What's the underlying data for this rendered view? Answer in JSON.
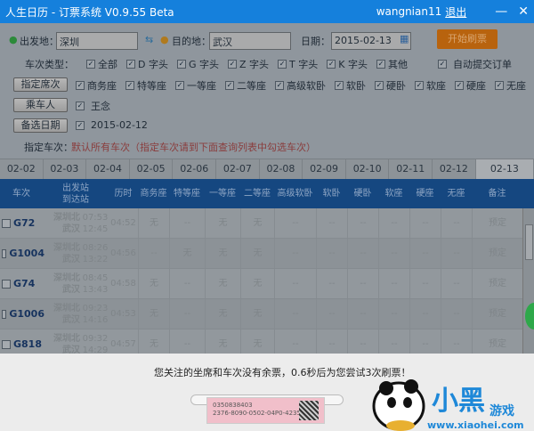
{
  "titlebar": {
    "title": "人生日历 - 订票系统 V0.9.55 Beta",
    "user": "wangnian11",
    "logout": "退出",
    "minimize": "—",
    "close": "✕"
  },
  "form": {
    "from_label": "出发地：",
    "from_value": "深圳",
    "to_label": "目的地：",
    "to_value": "武汉",
    "date_label": "日期：",
    "date_value": "2015-02-13",
    "start_button": "开始刷票",
    "train_type_label": "车次类型：",
    "train_types": [
      "全部",
      "D 字头",
      "G 字头",
      "Z 字头",
      "T 字头",
      "K 字头",
      "其他"
    ],
    "auto_submit": "自动提交订单",
    "seat_button": "指定席次",
    "seats": [
      "商务座",
      "特等座",
      "一等座",
      "二等座",
      "高级软卧",
      "软卧",
      "硬卧",
      "软座",
      "硬座",
      "无座"
    ],
    "passenger_button": "乘车人",
    "passenger": "王念",
    "alt_date_button": "备选日期",
    "alt_date": "2015-02-12",
    "train_label": "指定车次：",
    "train_hint": "默认所有车次（指定车次请到下面查询列表中勾选车次）"
  },
  "date_tabs": [
    "02-02",
    "02-03",
    "02-04",
    "02-05",
    "02-06",
    "02-07",
    "02-08",
    "02-09",
    "02-10",
    "02-11",
    "02-12",
    "02-13"
  ],
  "table": {
    "headers": {
      "train": "车次",
      "station1": "出发站",
      "station2": "到达站",
      "duration": "历时",
      "seats": [
        "商务座",
        "特等座",
        "一等座",
        "二等座",
        "高级软卧",
        "软卧",
        "硬卧",
        "软座",
        "硬座",
        "无座"
      ],
      "note": "备注"
    },
    "rows": [
      {
        "code": "G72",
        "from": "深圳北",
        "to": "武汉",
        "dep": "07:53",
        "arr": "12:45",
        "dur": "04:52",
        "seats": [
          "无",
          "--",
          "无",
          "无",
          "--",
          "--",
          "--",
          "--",
          "--",
          "--"
        ],
        "note": "预定"
      },
      {
        "code": "G1004",
        "from": "深圳北",
        "to": "武汉",
        "dep": "08:26",
        "arr": "13:22",
        "dur": "04:56",
        "seats": [
          "--",
          "无",
          "无",
          "无",
          "--",
          "--",
          "--",
          "--",
          "--",
          "--"
        ],
        "note": "预定"
      },
      {
        "code": "G74",
        "from": "深圳北",
        "to": "武汉",
        "dep": "08:45",
        "arr": "13:43",
        "dur": "04:58",
        "seats": [
          "无",
          "--",
          "无",
          "无",
          "--",
          "--",
          "--",
          "--",
          "--",
          "--"
        ],
        "note": "预定"
      },
      {
        "code": "G1006",
        "from": "深圳北",
        "to": "武汉",
        "dep": "09:23",
        "arr": "14:16",
        "dur": "04:53",
        "seats": [
          "无",
          "--",
          "无",
          "无",
          "--",
          "--",
          "--",
          "--",
          "--",
          "--"
        ],
        "note": "预定"
      },
      {
        "code": "G818",
        "from": "深圳北",
        "to": "武汉",
        "dep": "09:32",
        "arr": "14:29",
        "dur": "04:57",
        "seats": [
          "无",
          "--",
          "无",
          "无",
          "--",
          "--",
          "--",
          "--",
          "--",
          "--"
        ],
        "note": "预定"
      }
    ]
  },
  "status": {
    "message": "您关注的坐席和车次没有余票，0.6秒后为您尝试3次刷票！",
    "ticket_line1": "0350838403",
    "ticket_line2": "2376-8090-0502-04P0-4235-3"
  },
  "watermark": {
    "logo": "小黑游戏",
    "url": "www.xiaohei.com"
  }
}
